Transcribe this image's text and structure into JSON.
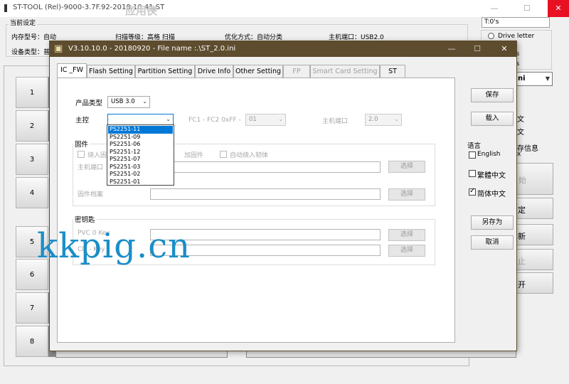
{
  "bg_window": {
    "title": "ST-TOOL (Rel)-9000-3.7F.92-2018.10.41.ST",
    "logo_overlay": "应用侠",
    "min_glyph": "—",
    "max_glyph": "☐",
    "close_glyph": "✕"
  },
  "current_settings": {
    "group_label": "当前设定",
    "memory_model": "内存型号：自动",
    "scan_level": "扫描等级：高格 扫描",
    "optimize": "优化方式：自动分类",
    "host_port": "主机端口：USB2.0",
    "device_type": "设备类型：普"
  },
  "right_panel": {
    "t_field": "T:0's",
    "drive_letter": "Drive letter",
    "frag1": "ts",
    "frag2": "ts",
    "select_fragment": "ni",
    "lang_frag1": "文",
    "lang_frag2": "文",
    "info_frag": "存信息",
    "info_frag2": "x",
    "btn_start": "始",
    "btn_confirm": "定",
    "btn_refresh": "新",
    "btn_stop": "止",
    "btn_open": "开"
  },
  "ports": [
    "1",
    "2",
    "3",
    "4",
    "5",
    "6",
    "7",
    "8"
  ],
  "dialog": {
    "title": "V3.10.10.0 - 20180920  -  File name :.\\ST_2.0.ini",
    "min_glyph": "—",
    "max_glyph": "☐",
    "close_glyph": "✕",
    "tabs": [
      {
        "label": "IC _FW"
      },
      {
        "label": "Flash Setting"
      },
      {
        "label": "Partition Setting"
      },
      {
        "label": "Drive Info"
      },
      {
        "label": "Other Setting"
      },
      {
        "label": "FP"
      },
      {
        "label": "Smart Card Setting"
      },
      {
        "label": "ST"
      }
    ],
    "product_type_label": "产品类型",
    "product_type_value": "USB 3.0",
    "controller_label": "主控",
    "controller_value": "",
    "fc_label": "FC1 - FC2   0xFF -",
    "fc_value": "01",
    "host_port_label": "主机端口",
    "host_port_value": "2.0",
    "firmware_group": "固件",
    "burn_fw_chk": "烧入固件",
    "add_fw_chk": "加固件",
    "auto_burn_chk": "自动烧入韧体",
    "fw_host_port_label": "主机端口",
    "fw_file_label": "固件档案",
    "select_btn": "选择",
    "key_group": "密钥匙",
    "pvc_key_label": "PVC 0 Key",
    "cd_key_label": "CD - Key",
    "save_btn": "保存",
    "load_btn": "载入",
    "save_as_btn": "另存为",
    "cancel_btn": "取消",
    "language_label": "语言",
    "lang_english": "English",
    "lang_trad": "繁體中文",
    "lang_simp": "简体中文",
    "dropdown_items": [
      "PS2251-11",
      "PS2251-09",
      "PS2251-06",
      "PS2251-12",
      "PS2251-07",
      "PS2251-03",
      "PS2251-02",
      "PS2251-01"
    ]
  },
  "watermark": "kkpig.cn"
}
